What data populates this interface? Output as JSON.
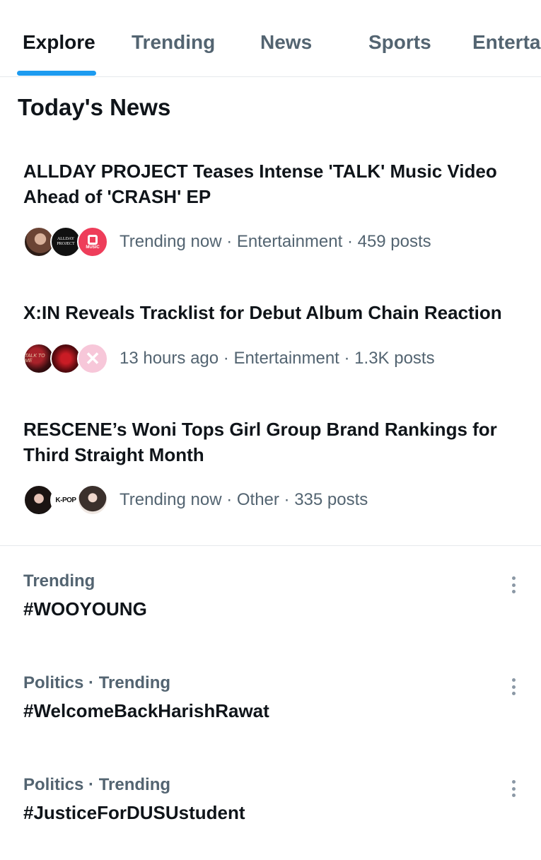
{
  "tabs": [
    {
      "label": "Explore",
      "active": true
    },
    {
      "label": "Trending",
      "active": false
    },
    {
      "label": "News",
      "active": false
    },
    {
      "label": "Sports",
      "active": false
    },
    {
      "label": "Entertai",
      "active": false
    }
  ],
  "accent_color": "#1d9bf0",
  "section_title": "Today's News",
  "news": [
    {
      "headline": "ALLDAY PROJECT Teases Intense 'TALK' Music Video Ahead of 'CRASH' EP",
      "meta": "Trending now · Entertainment · 459 posts",
      "avatars": [
        "avatar-portrait",
        "allday-project-logo",
        "music-app-logo"
      ],
      "avatar_text": {
        "logo": "ALLDAY PROJECT",
        "music": "MUSIC"
      }
    },
    {
      "headline": "X:IN Reveals Tracklist for Debut Album Chain Reaction",
      "meta": "13 hours ago · Entertainment · 1.3K posts",
      "avatars": [
        "album-cover",
        "red-portrait",
        "xin-logo"
      ],
      "avatar_text": {
        "cover": "TALK TO ME"
      }
    },
    {
      "headline": "RESCENE’s Woni Tops Girl Group Brand Rankings for Third Straight Month",
      "meta": "Trending now · Other · 335 posts",
      "avatars": [
        "avatar-portrait",
        "kpop-logo",
        "avatar-portrait"
      ],
      "avatar_text": {
        "kpop": "K-POP"
      }
    }
  ],
  "trends": [
    {
      "context": "Trending",
      "name": "#WOOYOUNG"
    },
    {
      "context": "Politics · Trending",
      "name": "#WelcomeBackHarishRawat"
    },
    {
      "context": "Politics · Trending",
      "name": "#JusticeForDUSUstudent"
    }
  ]
}
